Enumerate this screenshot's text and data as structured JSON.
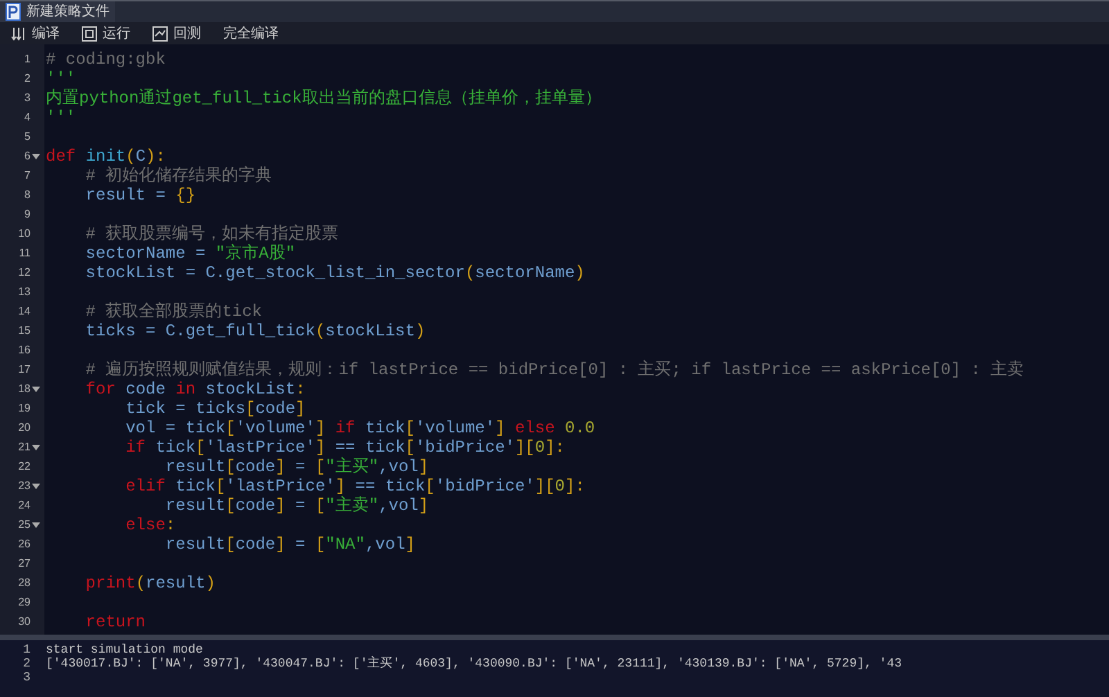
{
  "tab": {
    "title": "新建策略文件",
    "selected": true
  },
  "toolbar": [
    {
      "label": "编译"
    },
    {
      "label": "运行"
    },
    {
      "label": "回测"
    },
    {
      "label": "完全编译"
    }
  ],
  "editor": {
    "lines": [
      {
        "n": "1",
        "foldable": false,
        "tokens": [
          {
            "text": "# coding:gbk",
            "kind": "cmt"
          }
        ]
      },
      {
        "n": "2",
        "foldable": false,
        "tokens": [
          {
            "text": "'''",
            "kind": "str"
          }
        ]
      },
      {
        "n": "3",
        "foldable": false,
        "tokens": [
          {
            "text": "内置python通过get_full_tick取出当前的盘口信息（挂单价，挂单量）",
            "kind": "str"
          }
        ]
      },
      {
        "n": "4",
        "foldable": false,
        "tokens": [
          {
            "text": "'''",
            "kind": "str"
          }
        ]
      },
      {
        "n": "5",
        "foldable": false
      },
      {
        "n": "6",
        "foldable": true,
        "tokens": [
          {
            "text": "def ",
            "kind": "kw"
          },
          {
            "text": "init",
            "kind": "fn"
          },
          {
            "text": "(",
            "kind": "br"
          },
          {
            "text": "C",
            "kind": "id"
          },
          {
            "text": "):",
            "kind": "br"
          }
        ]
      },
      {
        "n": "7",
        "foldable": false,
        "tokens": [
          {
            "text": "    # 初始化储存结果的字典",
            "kind": "cmt"
          }
        ]
      },
      {
        "n": "8",
        "foldable": false,
        "tokens": [
          {
            "text": "    result = ",
            "kind": "id"
          },
          {
            "text": "{}",
            "kind": "br"
          }
        ]
      },
      {
        "n": "9",
        "foldable": false
      },
      {
        "n": "10",
        "foldable": false,
        "tokens": [
          {
            "text": "    # 获取股票编号，如未有指定股票",
            "kind": "cmt"
          }
        ]
      },
      {
        "n": "11",
        "foldable": false,
        "tokens": [
          {
            "text": "    sectorName = ",
            "kind": "id"
          },
          {
            "text": "\"京市A股\"",
            "kind": "str"
          }
        ]
      },
      {
        "n": "12",
        "foldable": false,
        "tokens": [
          {
            "text": "    stockList = C.get_stock_list_in_sector",
            "kind": "id"
          },
          {
            "text": "(",
            "kind": "br"
          },
          {
            "text": "sectorName",
            "kind": "id"
          },
          {
            "text": ")",
            "kind": "br"
          }
        ]
      },
      {
        "n": "13",
        "foldable": false
      },
      {
        "n": "14",
        "foldable": false,
        "tokens": [
          {
            "text": "    # 获取全部股票的tick",
            "kind": "cmt"
          }
        ]
      },
      {
        "n": "15",
        "foldable": false,
        "tokens": [
          {
            "text": "    ticks = C.get_full_tick",
            "kind": "id"
          },
          {
            "text": "(",
            "kind": "br"
          },
          {
            "text": "stockList",
            "kind": "id"
          },
          {
            "text": ")",
            "kind": "br"
          }
        ]
      },
      {
        "n": "16",
        "foldable": false
      },
      {
        "n": "17",
        "foldable": false,
        "tokens": [
          {
            "text": "    # 遍历按照规则赋值结果，规则：if lastPrice == bidPrice[0] : 主买; if lastPrice == askPrice[0] : 主卖",
            "kind": "cmt"
          }
        ]
      },
      {
        "n": "18",
        "foldable": true,
        "tokens": [
          {
            "text": "    for",
            "kind": "kw"
          },
          {
            "text": " code ",
            "kind": "id"
          },
          {
            "text": "in",
            "kind": "kw"
          },
          {
            "text": " stockList",
            "kind": "id"
          },
          {
            "text": ":",
            "kind": "br"
          }
        ]
      },
      {
        "n": "19",
        "foldable": false,
        "tokens": [
          {
            "text": "        tick = ticks",
            "kind": "id"
          },
          {
            "text": "[",
            "kind": "br"
          },
          {
            "text": "code",
            "kind": "id"
          },
          {
            "text": "]",
            "kind": "br"
          }
        ]
      },
      {
        "n": "20",
        "foldable": false,
        "tokens": [
          {
            "text": "        vol = tick",
            "kind": "id"
          },
          {
            "text": "[",
            "kind": "br"
          },
          {
            "text": "'volume'",
            "kind": "id"
          },
          {
            "text": "] ",
            "kind": "br"
          },
          {
            "text": "if",
            "kind": "kw"
          },
          {
            "text": " tick",
            "kind": "id"
          },
          {
            "text": "[",
            "kind": "br"
          },
          {
            "text": "'volume'",
            "kind": "id"
          },
          {
            "text": "] ",
            "kind": "br"
          },
          {
            "text": "else",
            "kind": "kw"
          },
          {
            "text": " 0.0",
            "kind": "num"
          }
        ]
      },
      {
        "n": "21",
        "foldable": true,
        "tokens": [
          {
            "text": "        if",
            "kind": "kw"
          },
          {
            "text": " tick",
            "kind": "id"
          },
          {
            "text": "[",
            "kind": "br"
          },
          {
            "text": "'lastPrice'",
            "kind": "id"
          },
          {
            "text": "]",
            "kind": "br"
          },
          {
            "text": " == tick",
            "kind": "id"
          },
          {
            "text": "[",
            "kind": "br"
          },
          {
            "text": "'bidPrice'",
            "kind": "id"
          },
          {
            "text": "][",
            "kind": "br"
          },
          {
            "text": "0",
            "kind": "num"
          },
          {
            "text": "]:",
            "kind": "br"
          }
        ]
      },
      {
        "n": "22",
        "foldable": false,
        "tokens": [
          {
            "text": "            result",
            "kind": "id"
          },
          {
            "text": "[",
            "kind": "br"
          },
          {
            "text": "code",
            "kind": "id"
          },
          {
            "text": "]",
            "kind": "br"
          },
          {
            "text": " = ",
            "kind": "id"
          },
          {
            "text": "[",
            "kind": "br"
          },
          {
            "text": "\"主买\"",
            "kind": "str"
          },
          {
            "text": ",vol",
            "kind": "id"
          },
          {
            "text": "]",
            "kind": "br"
          }
        ]
      },
      {
        "n": "23",
        "foldable": true,
        "tokens": [
          {
            "text": "        elif",
            "kind": "kw"
          },
          {
            "text": " tick",
            "kind": "id"
          },
          {
            "text": "[",
            "kind": "br"
          },
          {
            "text": "'lastPrice'",
            "kind": "id"
          },
          {
            "text": "]",
            "kind": "br"
          },
          {
            "text": " == tick",
            "kind": "id"
          },
          {
            "text": "[",
            "kind": "br"
          },
          {
            "text": "'bidPrice'",
            "kind": "id"
          },
          {
            "text": "][",
            "kind": "br"
          },
          {
            "text": "0",
            "kind": "num"
          },
          {
            "text": "]:",
            "kind": "br"
          }
        ]
      },
      {
        "n": "24",
        "foldable": false,
        "tokens": [
          {
            "text": "            result",
            "kind": "id"
          },
          {
            "text": "[",
            "kind": "br"
          },
          {
            "text": "code",
            "kind": "id"
          },
          {
            "text": "]",
            "kind": "br"
          },
          {
            "text": " = ",
            "kind": "id"
          },
          {
            "text": "[",
            "kind": "br"
          },
          {
            "text": "\"主卖\"",
            "kind": "str"
          },
          {
            "text": ",vol",
            "kind": "id"
          },
          {
            "text": "]",
            "kind": "br"
          }
        ]
      },
      {
        "n": "25",
        "foldable": true,
        "tokens": [
          {
            "text": "        else",
            "kind": "kw"
          },
          {
            "text": ":",
            "kind": "br"
          }
        ]
      },
      {
        "n": "26",
        "foldable": false,
        "tokens": [
          {
            "text": "            result",
            "kind": "id"
          },
          {
            "text": "[",
            "kind": "br"
          },
          {
            "text": "code",
            "kind": "id"
          },
          {
            "text": "]",
            "kind": "br"
          },
          {
            "text": " = ",
            "kind": "id"
          },
          {
            "text": "[",
            "kind": "br"
          },
          {
            "text": "\"NA\"",
            "kind": "str"
          },
          {
            "text": ",vol",
            "kind": "id"
          },
          {
            "text": "]",
            "kind": "br"
          }
        ]
      },
      {
        "n": "27",
        "foldable": false
      },
      {
        "n": "28",
        "foldable": false,
        "tokens": [
          {
            "text": "    print",
            "kind": "kw"
          },
          {
            "text": "(",
            "kind": "br"
          },
          {
            "text": "result",
            "kind": "id"
          },
          {
            "text": ")",
            "kind": "br"
          }
        ]
      },
      {
        "n": "29",
        "foldable": false
      },
      {
        "n": "30",
        "foldable": false,
        "tokens": [
          {
            "text": "    return",
            "kind": "kw"
          }
        ]
      }
    ]
  },
  "output": {
    "lines": [
      {
        "n": "1",
        "text": "start simulation mode"
      },
      {
        "n": "2",
        "text": "['430017.BJ': ['NA', 3977], '430047.BJ': ['主买', 4603], '430090.BJ': ['NA', 23111], '430139.BJ': ['NA', 5729], '43"
      },
      {
        "n": "3"
      }
    ]
  }
}
